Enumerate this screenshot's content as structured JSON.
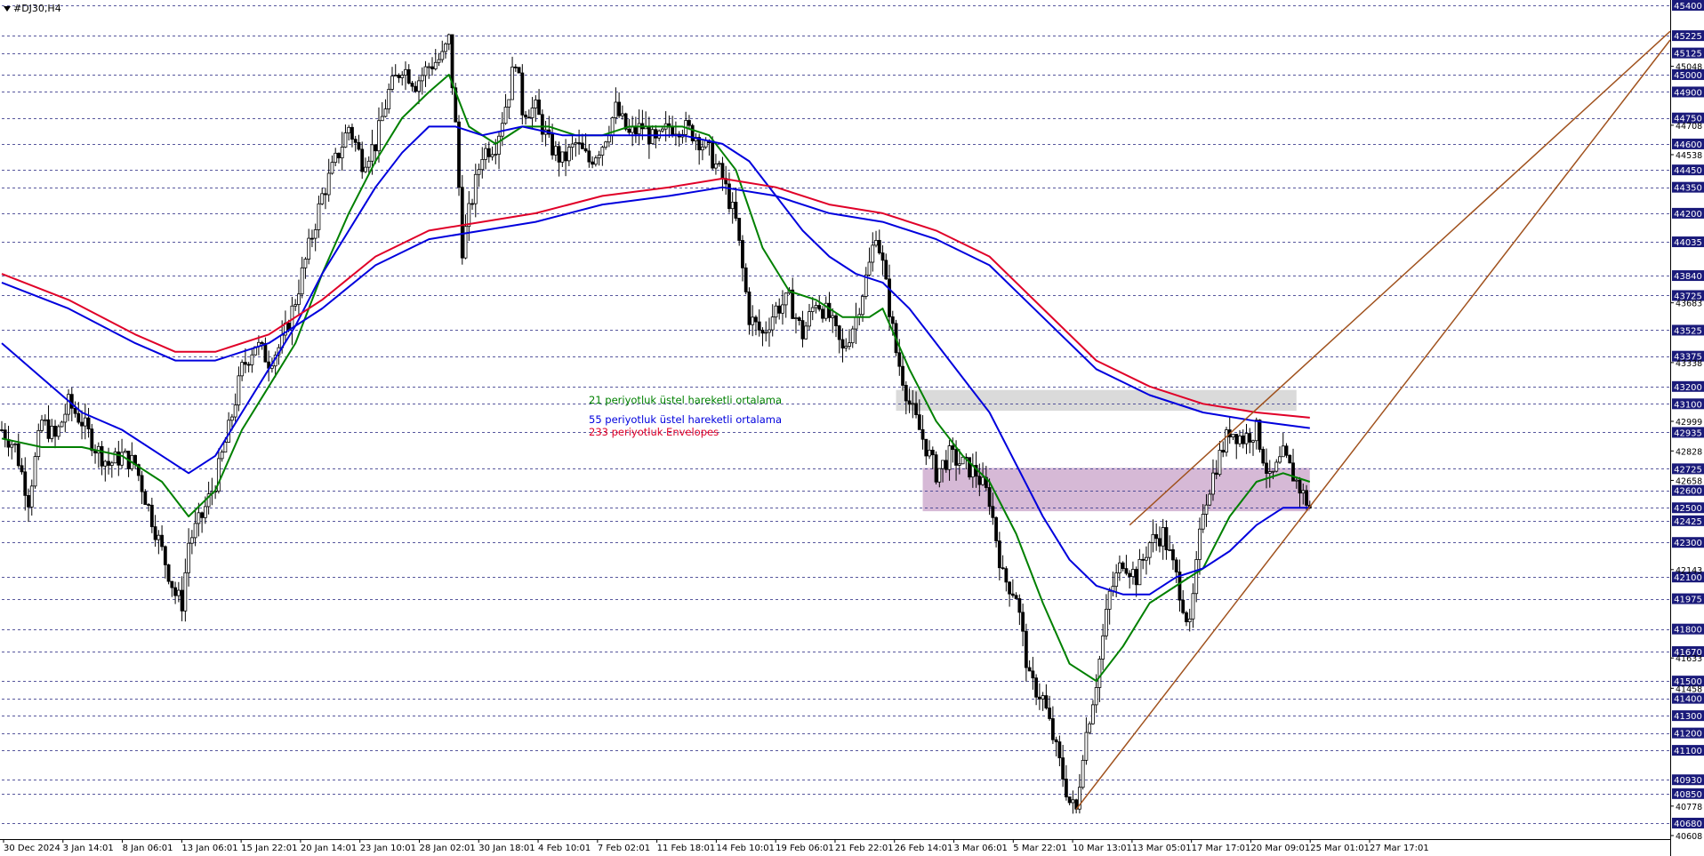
{
  "symbol": "#DJ30,H4",
  "colors": {
    "background": "#ffffff",
    "grid": "#3a3a8c",
    "candle": "#000000",
    "ema21": "#008000",
    "ema55": "#0000dd",
    "envelope": "#e00028",
    "channel": "#a0521e",
    "zone_grey": "#d6d6d6",
    "zone_purple": "#c8a2c8",
    "axis_text": "#000000",
    "price_label_bg": "#1a1a7a",
    "price_label_text": "#ffffff"
  },
  "legend": {
    "ema21_label": "21 periyotluk üstel hareketli ortalama",
    "ema55_label": "55 periyotluk üstel hareketli ortalama",
    "envelope_label": "233 periyotluk Envelopes"
  },
  "chart_data": {
    "type": "candlestick",
    "symbol": "#DJ30",
    "timeframe": "H4",
    "y_range": [
      40608,
      45400
    ],
    "grid": true,
    "price_levels": [
      45400,
      45225,
      45125,
      45000,
      44900,
      44750,
      44600,
      44450,
      44350,
      44200,
      44035,
      43840,
      43725,
      43525,
      43375,
      43200,
      43100,
      42935,
      42725,
      42600,
      42500,
      42425,
      42300,
      42100,
      41975,
      41800,
      41670,
      41500,
      41400,
      41300,
      41200,
      41100,
      40930,
      40850,
      40680
    ],
    "extra_price_ticks": [
      45048,
      44708,
      44538,
      43683,
      43338,
      42999,
      42828,
      42658,
      42143,
      41633,
      41458,
      40778,
      40608
    ],
    "x_labels": [
      "30 Dec 2024",
      "3 Jan 14:01",
      "8 Jan 06:01",
      "13 Jan 06:01",
      "15 Jan 22:01",
      "20 Jan 14:01",
      "23 Jan 10:01",
      "28 Jan 02:01",
      "30 Jan 18:01",
      "4 Feb 10:01",
      "7 Feb 02:01",
      "11 Feb 18:01",
      "14 Feb 10:01",
      "19 Feb 06:01",
      "21 Feb 22:01",
      "26 Feb 14:01",
      "3 Mar 06:01",
      "5 Mar 22:01",
      "10 Mar 13:01",
      "13 Mar 05:01",
      "17 Mar 17:01",
      "20 Mar 09:01",
      "25 Mar 01:01",
      "27 Mar 17:01"
    ],
    "price_path": [
      [
        0,
        42950
      ],
      [
        2,
        42850
      ],
      [
        4,
        42550
      ],
      [
        6,
        43000
      ],
      [
        8,
        42900
      ],
      [
        10,
        43100
      ],
      [
        12,
        43000
      ],
      [
        14,
        42850
      ],
      [
        16,
        42750
      ],
      [
        18,
        42800
      ],
      [
        20,
        42750
      ],
      [
        22,
        42500
      ],
      [
        24,
        42250
      ],
      [
        26,
        42000
      ],
      [
        27,
        41950
      ],
      [
        28,
        42300
      ],
      [
        30,
        42450
      ],
      [
        32,
        42650
      ],
      [
        34,
        42950
      ],
      [
        36,
        43300
      ],
      [
        38,
        43450
      ],
      [
        40,
        43350
      ],
      [
        42,
        43450
      ],
      [
        44,
        43700
      ],
      [
        46,
        44000
      ],
      [
        48,
        44300
      ],
      [
        50,
        44500
      ],
      [
        52,
        44700
      ],
      [
        54,
        44500
      ],
      [
        56,
        44600
      ],
      [
        58,
        44900
      ],
      [
        60,
        45050
      ],
      [
        62,
        44950
      ],
      [
        64,
        45050
      ],
      [
        66,
        45100
      ],
      [
        67,
        45200
      ],
      [
        68,
        44700
      ],
      [
        69,
        44000
      ],
      [
        70,
        44200
      ],
      [
        72,
        44550
      ],
      [
        74,
        44600
      ],
      [
        76,
        44900
      ],
      [
        77,
        45100
      ],
      [
        78,
        44800
      ],
      [
        80,
        44800
      ],
      [
        82,
        44600
      ],
      [
        84,
        44500
      ],
      [
        86,
        44600
      ],
      [
        88,
        44500
      ],
      [
        90,
        44600
      ],
      [
        92,
        44800
      ],
      [
        94,
        44650
      ],
      [
        96,
        44700
      ],
      [
        98,
        44600
      ],
      [
        100,
        44700
      ],
      [
        102,
        44700
      ],
      [
        104,
        44650
      ],
      [
        106,
        44550
      ],
      [
        108,
        44400
      ],
      [
        110,
        44150
      ],
      [
        112,
        43600
      ],
      [
        114,
        43500
      ],
      [
        116,
        43650
      ],
      [
        118,
        43700
      ],
      [
        120,
        43500
      ],
      [
        122,
        43700
      ],
      [
        124,
        43600
      ],
      [
        126,
        43400
      ],
      [
        128,
        43600
      ],
      [
        130,
        43900
      ],
      [
        131,
        44100
      ],
      [
        132,
        43900
      ],
      [
        134,
        43400
      ],
      [
        136,
        43100
      ],
      [
        138,
        42900
      ],
      [
        140,
        42700
      ],
      [
        142,
        42800
      ],
      [
        144,
        42750
      ],
      [
        146,
        42700
      ],
      [
        148,
        42550
      ],
      [
        150,
        42100
      ],
      [
        152,
        42000
      ],
      [
        154,
        41500
      ],
      [
        156,
        41400
      ],
      [
        158,
        41100
      ],
      [
        160,
        40800
      ],
      [
        161,
        40750
      ],
      [
        162,
        41100
      ],
      [
        164,
        41500
      ],
      [
        166,
        42000
      ],
      [
        168,
        42200
      ],
      [
        170,
        42100
      ],
      [
        172,
        42300
      ],
      [
        174,
        42350
      ],
      [
        176,
        42100
      ],
      [
        178,
        41800
      ],
      [
        180,
        42500
      ],
      [
        182,
        42750
      ],
      [
        184,
        42950
      ],
      [
        186,
        42900
      ],
      [
        188,
        42950
      ],
      [
        190,
        42650
      ],
      [
        192,
        42800
      ],
      [
        194,
        42650
      ],
      [
        196,
        42500
      ]
    ],
    "series": [
      {
        "name": "21 periyotluk üstel hareketli ortalama",
        "color": "#008000",
        "points": [
          [
            0,
            42900
          ],
          [
            6,
            42850
          ],
          [
            12,
            42850
          ],
          [
            18,
            42800
          ],
          [
            24,
            42650
          ],
          [
            28,
            42450
          ],
          [
            32,
            42600
          ],
          [
            36,
            42950
          ],
          [
            40,
            43200
          ],
          [
            44,
            43450
          ],
          [
            48,
            43850
          ],
          [
            52,
            44200
          ],
          [
            56,
            44500
          ],
          [
            60,
            44750
          ],
          [
            64,
            44900
          ],
          [
            67,
            45000
          ],
          [
            70,
            44700
          ],
          [
            74,
            44600
          ],
          [
            78,
            44700
          ],
          [
            82,
            44700
          ],
          [
            86,
            44650
          ],
          [
            90,
            44650
          ],
          [
            94,
            44700
          ],
          [
            98,
            44700
          ],
          [
            102,
            44700
          ],
          [
            106,
            44650
          ],
          [
            110,
            44450
          ],
          [
            114,
            44000
          ],
          [
            118,
            43750
          ],
          [
            122,
            43700
          ],
          [
            126,
            43600
          ],
          [
            130,
            43600
          ],
          [
            132,
            43650
          ],
          [
            136,
            43300
          ],
          [
            140,
            43000
          ],
          [
            144,
            42800
          ],
          [
            148,
            42650
          ],
          [
            152,
            42350
          ],
          [
            156,
            41950
          ],
          [
            160,
            41600
          ],
          [
            164,
            41500
          ],
          [
            168,
            41700
          ],
          [
            172,
            41950
          ],
          [
            176,
            42050
          ],
          [
            180,
            42150
          ],
          [
            184,
            42450
          ],
          [
            188,
            42650
          ],
          [
            192,
            42700
          ],
          [
            196,
            42650
          ]
        ]
      },
      {
        "name": "55 periyotluk üstel hareketli ortalama",
        "color": "#0000dd",
        "points": [
          [
            0,
            43450
          ],
          [
            6,
            43250
          ],
          [
            12,
            43050
          ],
          [
            18,
            42950
          ],
          [
            24,
            42800
          ],
          [
            28,
            42700
          ],
          [
            32,
            42800
          ],
          [
            36,
            43050
          ],
          [
            40,
            43300
          ],
          [
            44,
            43550
          ],
          [
            48,
            43850
          ],
          [
            52,
            44100
          ],
          [
            56,
            44350
          ],
          [
            60,
            44550
          ],
          [
            64,
            44700
          ],
          [
            68,
            44700
          ],
          [
            72,
            44650
          ],
          [
            78,
            44700
          ],
          [
            84,
            44650
          ],
          [
            90,
            44650
          ],
          [
            96,
            44650
          ],
          [
            102,
            44650
          ],
          [
            108,
            44600
          ],
          [
            112,
            44500
          ],
          [
            116,
            44300
          ],
          [
            120,
            44100
          ],
          [
            124,
            43950
          ],
          [
            128,
            43850
          ],
          [
            132,
            43800
          ],
          [
            136,
            43650
          ],
          [
            140,
            43450
          ],
          [
            144,
            43250
          ],
          [
            148,
            43050
          ],
          [
            152,
            42750
          ],
          [
            156,
            42450
          ],
          [
            160,
            42200
          ],
          [
            164,
            42050
          ],
          [
            168,
            42000
          ],
          [
            172,
            42000
          ],
          [
            176,
            42100
          ],
          [
            180,
            42150
          ],
          [
            184,
            42250
          ],
          [
            188,
            42400
          ],
          [
            192,
            42500
          ],
          [
            196,
            42500
          ]
        ]
      },
      {
        "name": "233 periyotluk Envelopes",
        "color": "#e00028",
        "points": [
          [
            0,
            43850
          ],
          [
            10,
            43700
          ],
          [
            20,
            43500
          ],
          [
            26,
            43400
          ],
          [
            32,
            43400
          ],
          [
            40,
            43500
          ],
          [
            48,
            43700
          ],
          [
            56,
            43950
          ],
          [
            64,
            44100
          ],
          [
            72,
            44150
          ],
          [
            80,
            44200
          ],
          [
            90,
            44300
          ],
          [
            100,
            44350
          ],
          [
            108,
            44400
          ],
          [
            116,
            44350
          ],
          [
            124,
            44250
          ],
          [
            132,
            44200
          ],
          [
            140,
            44100
          ],
          [
            148,
            43950
          ],
          [
            156,
            43650
          ],
          [
            164,
            43350
          ],
          [
            172,
            43200
          ],
          [
            180,
            43100
          ],
          [
            188,
            43050
          ],
          [
            196,
            43020
          ]
        ]
      },
      {
        "name": "",
        "color": "#0000dd",
        "points": [
          [
            0,
            43800
          ],
          [
            10,
            43650
          ],
          [
            20,
            43450
          ],
          [
            26,
            43350
          ],
          [
            32,
            43350
          ],
          [
            40,
            43450
          ],
          [
            48,
            43650
          ],
          [
            56,
            43900
          ],
          [
            64,
            44050
          ],
          [
            72,
            44100
          ],
          [
            80,
            44150
          ],
          [
            90,
            44250
          ],
          [
            100,
            44300
          ],
          [
            108,
            44350
          ],
          [
            116,
            44300
          ],
          [
            124,
            44200
          ],
          [
            132,
            44150
          ],
          [
            140,
            44050
          ],
          [
            148,
            43900
          ],
          [
            156,
            43600
          ],
          [
            164,
            43300
          ],
          [
            172,
            43150
          ],
          [
            180,
            43050
          ],
          [
            188,
            43000
          ],
          [
            196,
            42960
          ]
        ]
      }
    ],
    "channel_lines": [
      {
        "from": [
          161,
          40760
        ],
        "to": [
          250,
          45200
        ]
      },
      {
        "from": [
          169,
          42400
        ],
        "to": [
          250,
          45250
        ]
      }
    ],
    "zones": [
      {
        "type": "grey",
        "from_x": 134,
        "to_x": 194,
        "y_low": 43060,
        "y_high": 43180
      },
      {
        "type": "purple",
        "from_x": 138,
        "to_x": 196,
        "y_low": 42480,
        "y_high": 42730
      }
    ]
  }
}
